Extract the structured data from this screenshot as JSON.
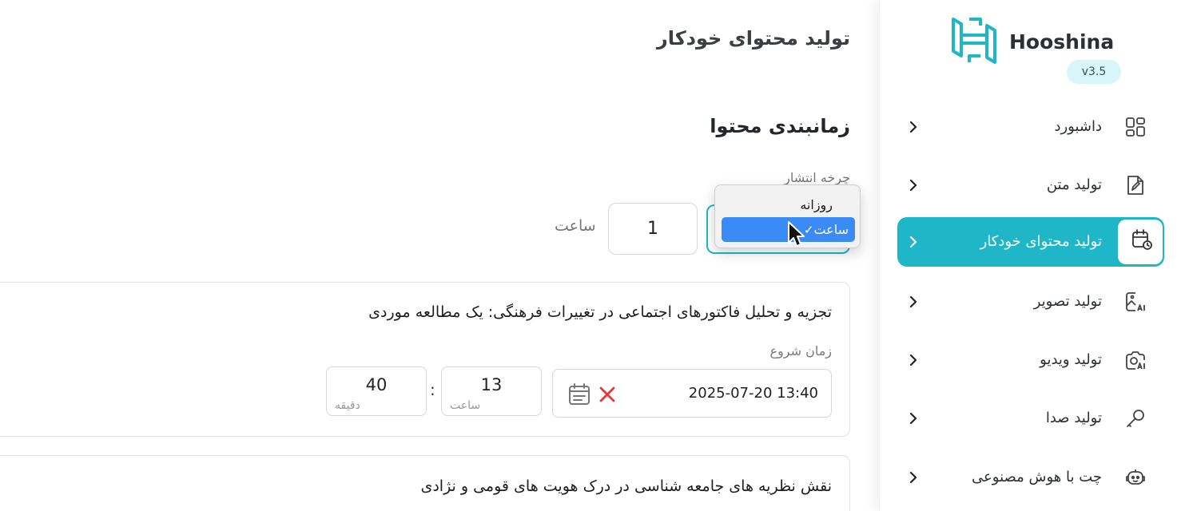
{
  "sidebar": {
    "brand": "Hooshina",
    "version": "v3.5",
    "items": [
      {
        "label": "داشبورد",
        "icon": "dashboard-icon",
        "active": false
      },
      {
        "label": "تولید متن",
        "icon": "edit-document-icon",
        "active": false
      },
      {
        "label": "تولید محتوای خودکار",
        "icon": "calendar-clock-icon",
        "active": true
      },
      {
        "label": "تولید تصویر",
        "icon": "ai-image-icon",
        "active": false
      },
      {
        "label": "تولید ویدیو",
        "icon": "ai-video-icon",
        "active": false
      },
      {
        "label": "تولید صدا",
        "icon": "microphone-icon",
        "active": false
      },
      {
        "label": "چت با هوش مصنوعی",
        "icon": "ai-chat-icon",
        "active": false
      }
    ]
  },
  "main": {
    "page_title": "تولید محتوای خودکار",
    "section_title": "زمانبندی محتوا",
    "cycle_label": "چرخه انتشار",
    "interval_value": "1",
    "interval_unit": "ساعت",
    "dropdown": {
      "options": [
        "روزانه",
        "ساعت"
      ],
      "selected": "ساعت"
    },
    "cards": [
      {
        "title": "تجزیه و تحلیل فاکتورهای اجتماعی در تغییرات فرهنگی: یک مطالعه موردی",
        "start_label": "زمان شروع",
        "datetime": "2025-07-20 13:40",
        "hour": "13",
        "hour_caption": "ساعت",
        "minute": "40",
        "minute_caption": "دقیقه"
      },
      {
        "title": "نقش نظریه های جامعه شناسی در درک هویت های قومی و نژادی"
      }
    ]
  },
  "colors": {
    "accent": "#1fb6c8",
    "selection": "#3a8bf5",
    "clear_red": "#e53935"
  }
}
